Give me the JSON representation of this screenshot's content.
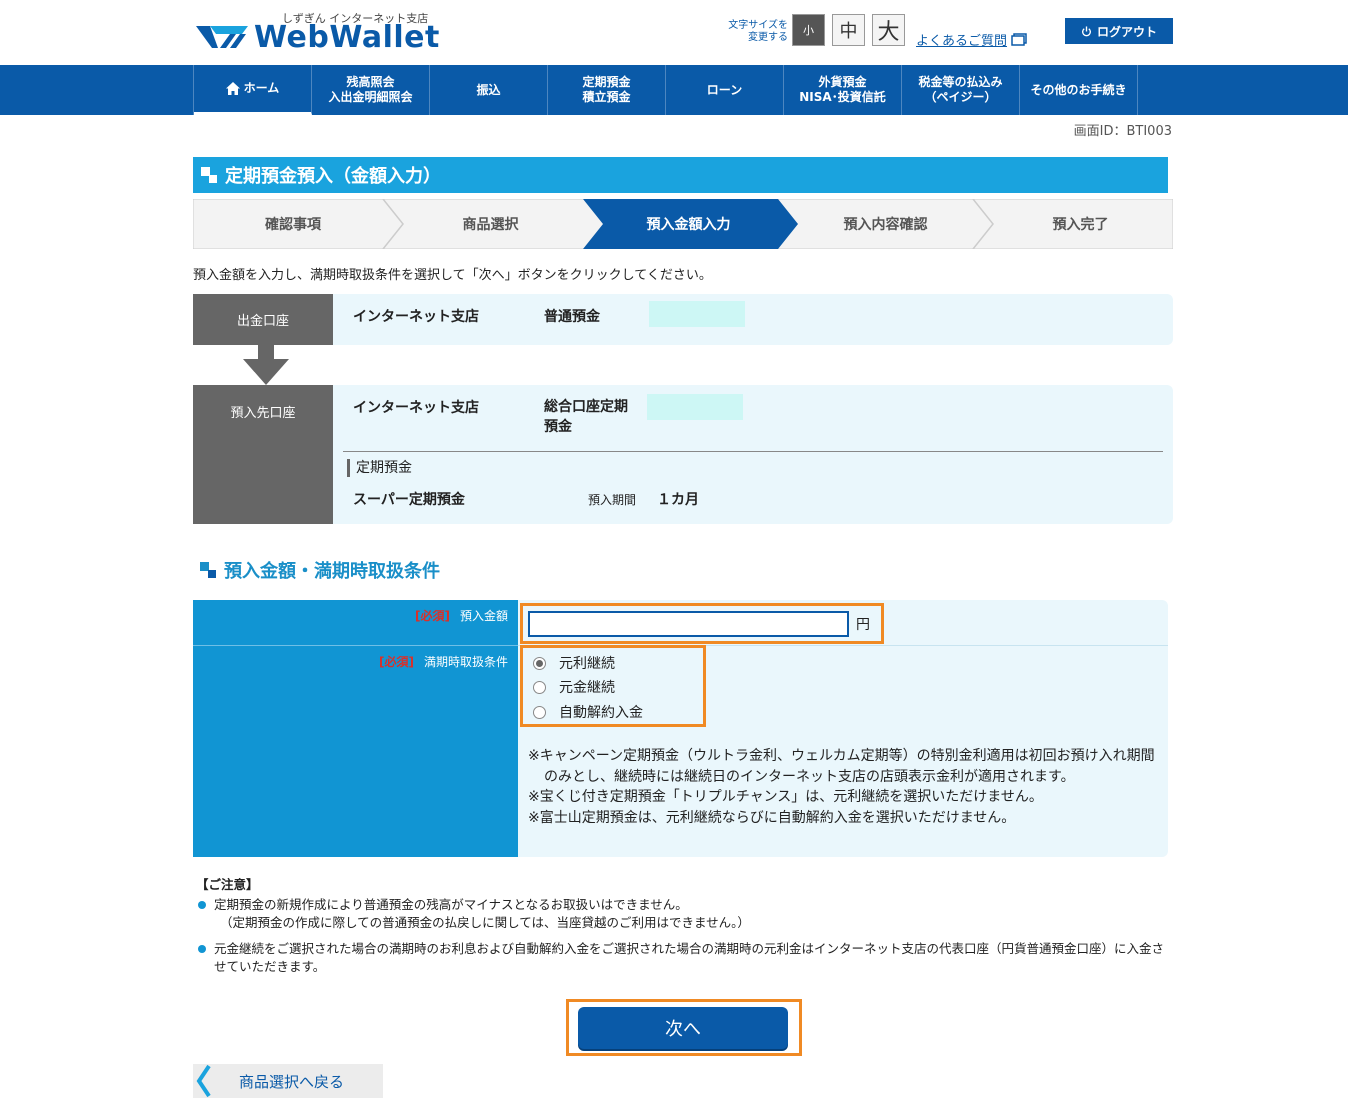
{
  "header": {
    "logo_sub": "しずぎん インターネット支店",
    "logo_text": "WebWallet",
    "fontsize_label_1": "文字サイズを",
    "fontsize_label_2": "変更する",
    "fs_small": "小",
    "fs_mid": "中",
    "fs_large": "大",
    "faq": "よくあるご質問",
    "logout": "ログアウト"
  },
  "nav": {
    "items": [
      {
        "label": "ホーム"
      },
      {
        "label": "残高照会\n入出金明細照会"
      },
      {
        "label": "振込"
      },
      {
        "label": "定期預金\n積立預金"
      },
      {
        "label": "ローン"
      },
      {
        "label": "外貨預金\nNISA･投資信託"
      },
      {
        "label": "税金等の払込み\n（ペイジー）"
      },
      {
        "label": "その他のお手続き"
      }
    ]
  },
  "screen_id": "画面ID：BTI003",
  "page_title": "定期預金預入（金額入力）",
  "steps": [
    {
      "label": "確認事項"
    },
    {
      "label": "商品選択"
    },
    {
      "label": "預入金額入力"
    },
    {
      "label": "預入内容確認"
    },
    {
      "label": "預入完了"
    }
  ],
  "instruction": "預入金額を入力し、満期時取扱条件を選択して「次へ」ボタンをクリックしてください。",
  "from_account": {
    "head": "出金口座",
    "branch": "インターネット支店",
    "type": "普通預金"
  },
  "to_account": {
    "head": "預入先口座",
    "branch": "インターネット支店",
    "type_1": "総合口座定期",
    "type_2": "預金",
    "sub_head": "定期預金",
    "product": "スーパー定期預金",
    "period_label": "預入期間",
    "period_value": "１カ月"
  },
  "section_title": "預入金額・満期時取扱条件",
  "form": {
    "required": "[必須]",
    "amount_label": "預入金額",
    "amount_value": "",
    "yen": "円",
    "maturity_label": "満期時取扱条件",
    "options": [
      {
        "label": "元利継続"
      },
      {
        "label": "元金継続"
      },
      {
        "label": "自動解約入金"
      }
    ],
    "notes": [
      "※キャンペーン定期預金（ウルトラ金利、ウェルカム定期等）の特別金利適用は初回お預け入れ期間のみとし、継続時には継続日のインターネット支店の店頭表示金利が適用されます。",
      "※宝くじ付き定期預金「トリプルチャンス」は、元利継続を選択いただけません。",
      "※富士山定期預金は、元利継続ならびに自動解約入金を選択いただけません。"
    ]
  },
  "caution": {
    "title": "【ご注意】",
    "items": [
      "定期預金の新規作成により普通預金の残高がマイナスとなるお取扱いはできません。",
      "（定期預金の作成に際しての普通預金の払戻しに関しては、当座貸越のご利用はできません。）",
      "元金継続をご選択された場合の満期時のお利息および自動解約入金をご選択された場合の満期時の元利金はインターネット支店の代表口座（円貨普通預金口座）に入金させていただきます。"
    ]
  },
  "buttons": {
    "next": "次へ",
    "back": "商品選択へ戻る"
  },
  "colors": {
    "primary": "#0a5aa8",
    "accent": "#1aa3de",
    "highlight": "#f08a24"
  }
}
